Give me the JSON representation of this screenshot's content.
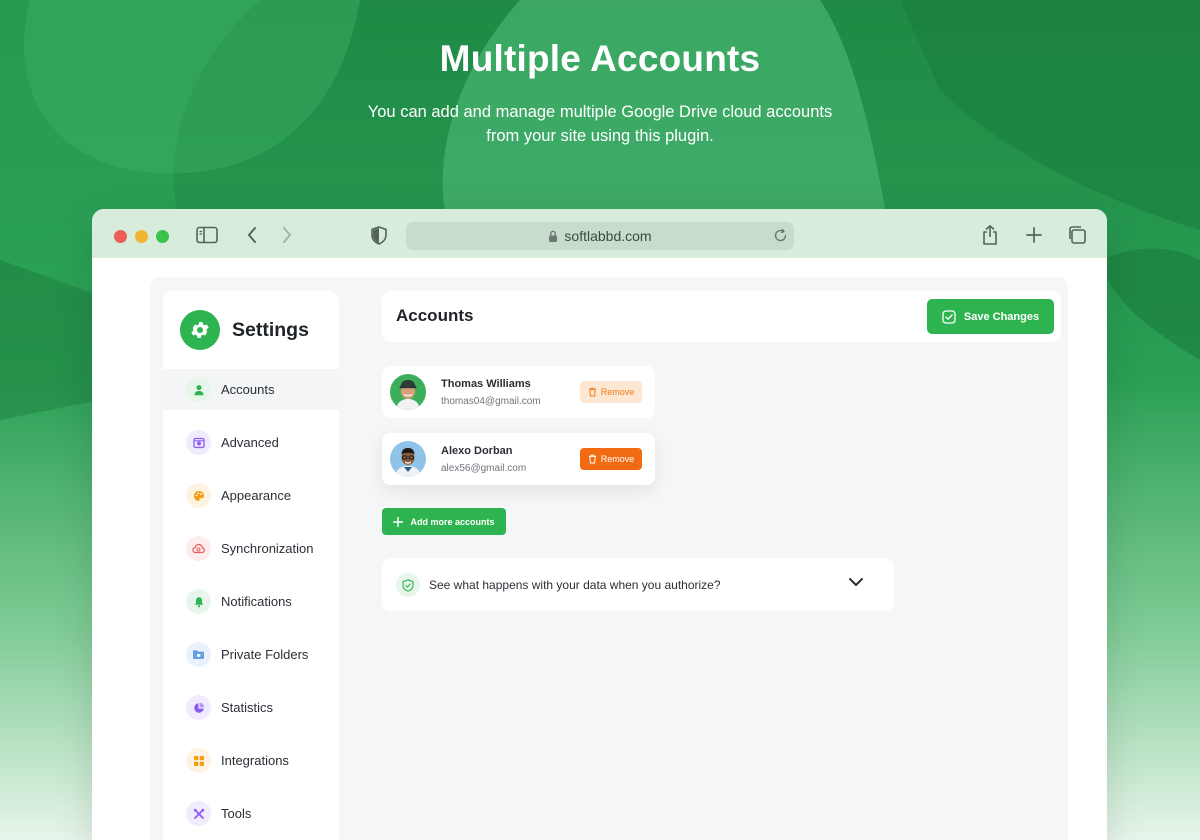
{
  "hero": {
    "title": "Multiple Accounts",
    "subtitle_line1": "You can add and manage multiple Google Drive cloud accounts",
    "subtitle_line2": "from your site using this plugin."
  },
  "browser": {
    "url": "softlabbd.com",
    "icons": [
      "sidebar-toggle-icon",
      "back-icon",
      "forward-icon",
      "shield-icon",
      "lock-icon",
      "reload-icon",
      "share-icon",
      "new-tab-icon",
      "tabs-overview-icon"
    ]
  },
  "sidebar": {
    "title": "Settings",
    "items": [
      {
        "label": "Accounts",
        "icon": "user-icon",
        "color": "#2db34f",
        "bg": "#e6f6ea",
        "active": true
      },
      {
        "label": "Advanced",
        "icon": "advanced-icon",
        "color": "#8b5cf6",
        "bg": "#f1ebfe"
      },
      {
        "label": "Appearance",
        "icon": "palette-icon",
        "color": "#f59e0b",
        "bg": "#fef3e2"
      },
      {
        "label": "Synchronization",
        "icon": "cloud-sync-icon",
        "color": "#ef5b5b",
        "bg": "#fdecec"
      },
      {
        "label": "Notifications",
        "icon": "bell-icon",
        "color": "#2db34f",
        "bg": "#e6f6ea"
      },
      {
        "label": "Private Folders",
        "icon": "folder-icon",
        "color": "#4a90e2",
        "bg": "#e8f1fc"
      },
      {
        "label": "Statistics",
        "icon": "pie-chart-icon",
        "color": "#8b5cf6",
        "bg": "#f1ebfe"
      },
      {
        "label": "Integrations",
        "icon": "grid-icon",
        "color": "#f59e0b",
        "bg": "#fef3e2"
      },
      {
        "label": "Tools",
        "icon": "tools-icon",
        "color": "#8b5cf6",
        "bg": "#f1ebfe"
      }
    ]
  },
  "main": {
    "title": "Accounts",
    "save_label": "Save Changes",
    "accounts": [
      {
        "name": "Thomas Williams",
        "email": "thomas04@gmail.com",
        "remove_label": "Remove"
      },
      {
        "name": "Alexo Dorban",
        "email": "alex56@gmail.com",
        "remove_label": "Remove"
      }
    ],
    "add_label": "Add more accounts",
    "auth_text": "See what happens with your data when you authorize?"
  },
  "colors": {
    "brand_green": "#2db34f",
    "remove_orange": "#f26a11",
    "toolbar": "#d8ecdc"
  }
}
